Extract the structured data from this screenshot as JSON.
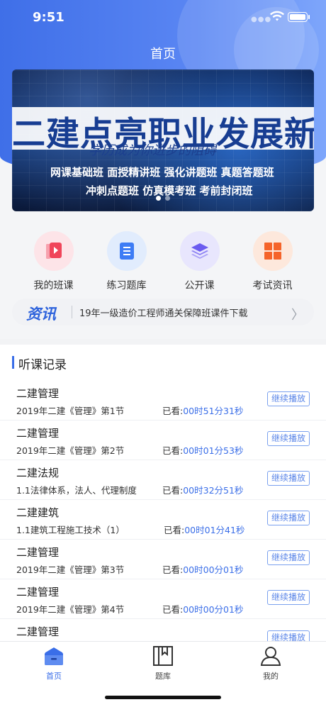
{
  "status_bar": {
    "time": "9:51"
  },
  "nav": {
    "title": "首页"
  },
  "banner": {
    "title": "二建点亮职业发展新",
    "subtitle": "学历成为你进步的阻碍",
    "courses_row1": "网课基础班  面授精讲班  强化讲题班  真题答题班",
    "courses_row2": "冲刺点题班  仿真模考班  考前封闭班",
    "slide_count": 2,
    "active_slide": 1
  },
  "quick_menu": [
    {
      "label": "我的班课",
      "icon": "play-icon",
      "color": "#f0455a"
    },
    {
      "label": "练习题库",
      "icon": "list-icon",
      "color": "#3d7cf5"
    },
    {
      "label": "公开课",
      "icon": "layers-icon",
      "color": "#6b5cf0"
    },
    {
      "label": "考试资讯",
      "icon": "grid-icon",
      "color": "#f5642a"
    }
  ],
  "news": {
    "badge": "资讯",
    "text": "19年一级造价工程师通关保障班课件下载"
  },
  "section": {
    "title": "听课记录"
  },
  "records": [
    {
      "course": "二建管理",
      "lesson": "2019年二建《管理》第1节",
      "watched_label": "已看:",
      "watched_time": "00时51分31秒",
      "button": "继续播放"
    },
    {
      "course": "二建管理",
      "lesson": "2019年二建《管理》第2节",
      "watched_label": "已看:",
      "watched_time": "00时01分53秒",
      "button": "继续播放"
    },
    {
      "course": "二建法规",
      "lesson": "1.1法律体系，法人、代理制度",
      "watched_label": "已看:",
      "watched_time": "00时32分51秒",
      "button": "继续播放"
    },
    {
      "course": "二建建筑",
      "lesson": "1.1建筑工程施工技术（1）",
      "watched_label": "已看:",
      "watched_time": "00时01分41秒",
      "button": "继续播放"
    },
    {
      "course": "二建管理",
      "lesson": "2019年二建《管理》第3节",
      "watched_label": "已看:",
      "watched_time": "00时00分01秒",
      "button": "继续播放"
    },
    {
      "course": "二建管理",
      "lesson": "2019年二建《管理》第4节",
      "watched_label": "已看:",
      "watched_time": "00时00分01秒",
      "button": "继续播放"
    },
    {
      "course": "二建管理",
      "lesson": "",
      "watched_label": "",
      "watched_time": "",
      "button": "继续播放"
    }
  ],
  "tabbar": [
    {
      "label": "首页",
      "icon": "home-icon",
      "active": true
    },
    {
      "label": "题库",
      "icon": "book-icon",
      "active": false
    },
    {
      "label": "我的",
      "icon": "user-icon",
      "active": false
    }
  ],
  "colors": {
    "primary": "#3a6ee8",
    "header_gradient_start": "#3f6fe8",
    "header_gradient_end": "#7ea6fb"
  }
}
